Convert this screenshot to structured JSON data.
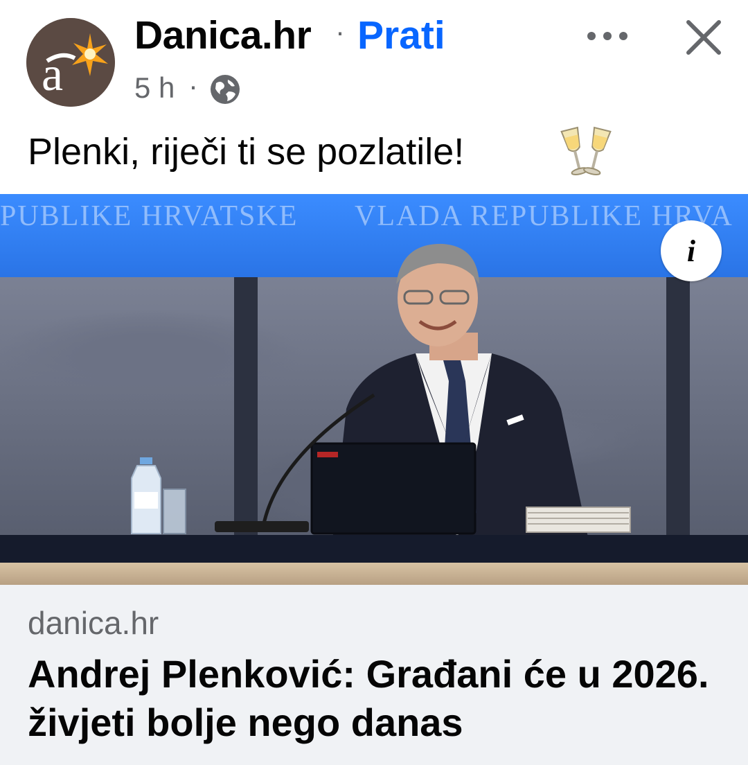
{
  "post": {
    "page_name": "Danica.hr",
    "separator": "·",
    "follow_label": "Prati",
    "time": "5 h",
    "meta_separator": "·",
    "audience_icon": "globe-icon",
    "text": "Plenki, riječi ti se pozlatile!",
    "emoji": "clinking-glasses-icon"
  },
  "image": {
    "banner_text_left": "PUBLIKE HRVATSKE",
    "banner_text_right": "VLADA REPUBLIKE HRVA",
    "info_label": "i"
  },
  "link": {
    "domain": "danica.hr",
    "title": "Andrej Plenković: Građani će u 2026. živjeti bolje nego danas"
  },
  "colors": {
    "accent": "#0866ff",
    "secondary_text": "#65676b",
    "preview_bg": "#f0f2f5"
  }
}
